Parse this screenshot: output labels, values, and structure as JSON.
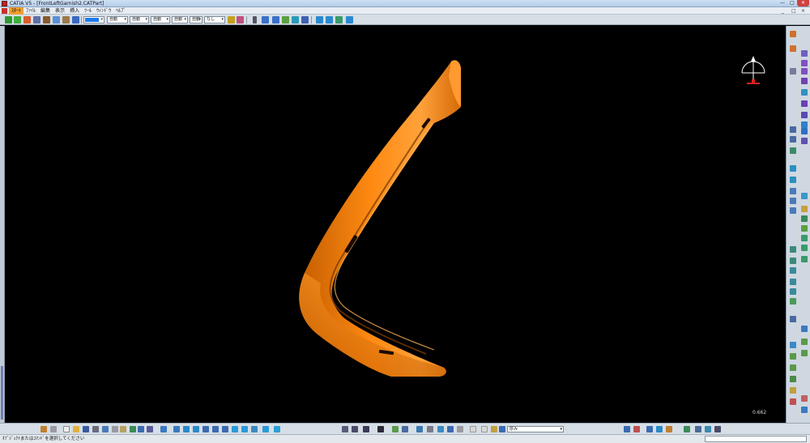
{
  "window": {
    "title": "CATIA V5 - [FrontLeftGarnish2.CATPart]",
    "minimize": "—",
    "maximize": "□",
    "close": "✕"
  },
  "menu": {
    "items": [
      {
        "label": "ｽﾀｰﾄ",
        "active": true
      },
      {
        "label": "ﾌｧｲﾙ"
      },
      {
        "label": "編集"
      },
      {
        "label": "表示"
      },
      {
        "label": "挿入"
      },
      {
        "label": "ﾂｰﾙ"
      },
      {
        "label": "ｳｨﾝﾄﾞｳ"
      },
      {
        "label": "ﾍﾙﾌﾟ"
      }
    ],
    "mdi_min": "_",
    "mdi_restore": "□",
    "mdi_close": "×"
  },
  "graphic_properties": {
    "fill_color": "#1e7bf0",
    "transparency": "自動",
    "line_color": "自動",
    "line_weight": "自動",
    "line_type": "自動",
    "point_symbol": "自動",
    "layer": "なし"
  },
  "viewport": {
    "background": "#000000",
    "part_color": "#ff8a12",
    "scale_readout": "0.662"
  },
  "bottom": {
    "material": "厚み"
  },
  "status": {
    "message": "ｵﾌﾞｼﾞｪｸﾄまたはｺﾏﾝﾄﾞを選択してください"
  }
}
